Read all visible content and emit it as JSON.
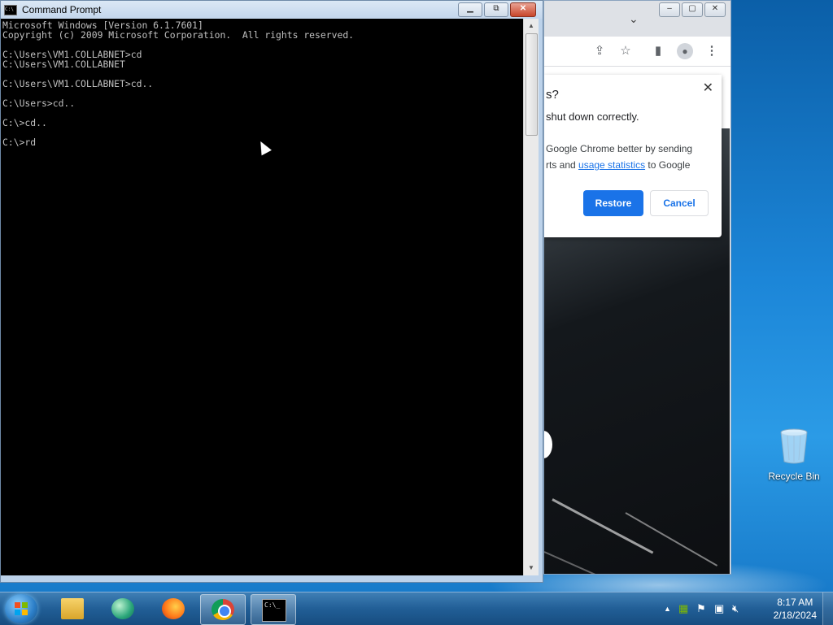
{
  "desktop": {
    "recycle_bin_label": "Recycle Bin"
  },
  "cmd_window": {
    "title": "Command Prompt",
    "console_lines": [
      "Microsoft Windows [Version 6.1.7601]",
      "Copyright (c) 2009 Microsoft Corporation.  All rights reserved.",
      "",
      "C:\\Users\\VM1.COLLABNET>cd",
      "C:\\Users\\VM1.COLLABNET",
      "",
      "C:\\Users\\VM1.COLLABNET>cd..",
      "",
      "C:\\Users>cd..",
      "",
      "C:\\>cd..",
      "",
      "C:\\>rd"
    ],
    "buttons": {
      "minimize": "▭",
      "maximize": "⧉",
      "close": "✕"
    }
  },
  "chrome_window": {
    "restore_dialog": {
      "title": "s?",
      "line1": "shut down correctly.",
      "line2": "Google Chrome better by sending",
      "line3_prefix": "rts and ",
      "line3_link": "usage statistics",
      "line3_suffix": " to Google",
      "restore_label": "Restore",
      "cancel_label": "Cancel",
      "close_glyph": "✕"
    },
    "toolbar_icons": [
      "share-icon",
      "star-icon",
      "side-panel-icon",
      "profile-icon",
      "menu-icon"
    ]
  },
  "taskbar": {
    "apps": [
      {
        "name": "windows-explorer",
        "active": false
      },
      {
        "name": "browser-globe",
        "active": false
      },
      {
        "name": "firefox",
        "active": false
      },
      {
        "name": "chrome",
        "active": true
      },
      {
        "name": "command-prompt",
        "active": true
      }
    ],
    "cmd_icon_text": "C:\\_",
    "clock_time": "8:17 AM",
    "clock_date": "2/18/2024"
  },
  "colors": {
    "chrome_blue": "#1a73e8",
    "console_bg": "#000000",
    "console_fg": "#c0c0c0"
  }
}
